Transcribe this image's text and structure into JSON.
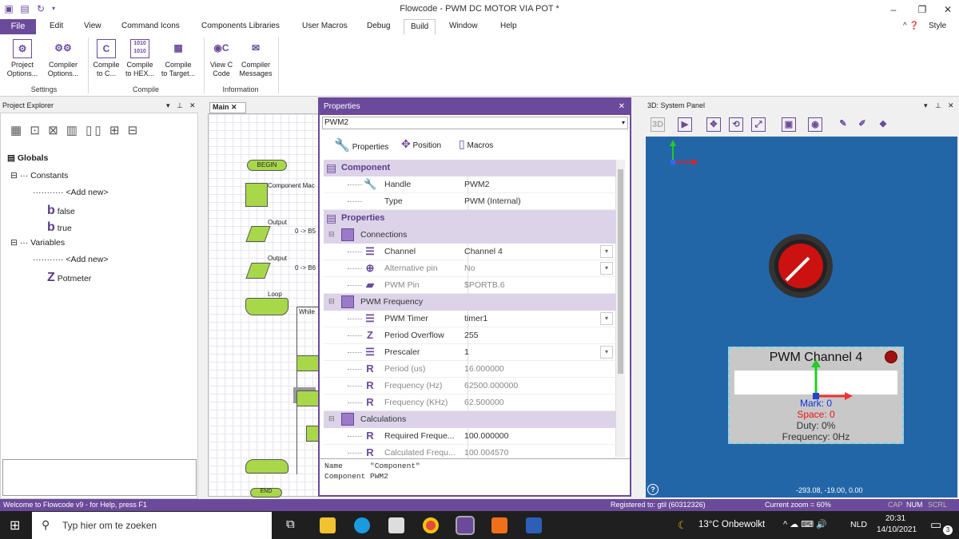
{
  "window": {
    "title": "Flowcode - PWM DC MOTOR VIA POT *"
  },
  "menu": [
    "File",
    "Edit",
    "View",
    "Command Icons",
    "Components Libraries",
    "User Macros",
    "Debug",
    "Build",
    "Window",
    "Help"
  ],
  "menu_style": "Style",
  "ribbon": {
    "buttons": [
      {
        "label1": "Project",
        "label2": "Options...",
        "icon": "gear-icon"
      },
      {
        "label1": "Compiler",
        "label2": "Options...",
        "icon": "gears-icon"
      },
      {
        "label1": "Compile",
        "label2": "to C...",
        "icon": "c-file-icon"
      },
      {
        "label1": "Compile",
        "label2": "to HEX...",
        "icon": "hex-file-icon"
      },
      {
        "label1": "Compile",
        "label2": "to Target...",
        "icon": "target-icon"
      },
      {
        "label1": "View C",
        "label2": "Code",
        "icon": "view-c-icon"
      },
      {
        "label1": "Compiler",
        "label2": "Messages",
        "icon": "messages-icon"
      }
    ],
    "groups": [
      "Settings",
      "Compile",
      "Information"
    ]
  },
  "project_explorer": {
    "title": "Project Explorer",
    "tree": [
      {
        "label": "Globals",
        "level": 0
      },
      {
        "label": "Constants",
        "level": 1
      },
      {
        "label": "<Add new>",
        "level": 2
      },
      {
        "label": "false",
        "level": 2,
        "icon": "b"
      },
      {
        "label": "true",
        "level": 2,
        "icon": "b"
      },
      {
        "label": "Variables",
        "level": 1
      },
      {
        "label": "<Add new>",
        "level": 2
      },
      {
        "label": "Potmeter",
        "level": 2,
        "icon": "Z"
      }
    ]
  },
  "main": {
    "tab": "Main",
    "flow": {
      "begin": "BEGIN",
      "end": "END",
      "component_macro": "Component Mac",
      "output1": "Output",
      "assign1": "0 -> B5",
      "output2": "Output",
      "assign2": "0 -> B6",
      "loop": "Loop",
      "while": "While"
    }
  },
  "properties": {
    "title": "Properties",
    "selected": "PWM2",
    "tabs": [
      "Properties",
      "Position",
      "Macros"
    ],
    "rows": [
      {
        "kind": "group",
        "label": "Component"
      },
      {
        "kind": "row",
        "key": "Handle",
        "value": "PWM2",
        "icon": "wrench"
      },
      {
        "kind": "row",
        "key": "Type",
        "value": "PWM (Internal)"
      },
      {
        "kind": "group",
        "label": "Properties"
      },
      {
        "kind": "sub",
        "label": "Connections"
      },
      {
        "kind": "row",
        "key": "Channel",
        "value": "Channel 4",
        "icon": "list",
        "dd": true
      },
      {
        "kind": "row",
        "key": "Alternative pin",
        "value": "No",
        "icon": "plus",
        "dd": true,
        "dim": true
      },
      {
        "kind": "row",
        "key": "PWM Pin",
        "value": "$PORTB.6",
        "icon": "pin",
        "dim": true
      },
      {
        "kind": "sub",
        "label": "PWM Frequency"
      },
      {
        "kind": "row",
        "key": "PWM Timer",
        "value": "timer1",
        "icon": "list",
        "dd": true
      },
      {
        "kind": "row",
        "key": "Period Overflow",
        "value": "255",
        "icon": "Z"
      },
      {
        "kind": "row",
        "key": "Prescaler",
        "value": "1",
        "icon": "list",
        "dd": true
      },
      {
        "kind": "row",
        "key": "Period (us)",
        "value": "16.000000",
        "icon": "R",
        "dim": true
      },
      {
        "kind": "row",
        "key": "Frequency (Hz)",
        "value": "62500.000000",
        "icon": "R",
        "dim": true
      },
      {
        "kind": "row",
        "key": "Frequency (KHz)",
        "value": "62.500000",
        "icon": "R",
        "dim": true
      },
      {
        "kind": "sub",
        "label": "Calculations"
      },
      {
        "kind": "row",
        "key": "Required Freque...",
        "value": "100.000000",
        "icon": "R"
      },
      {
        "kind": "row",
        "key": "Calculated Frequ...",
        "value": "100.004570",
        "icon": "R",
        "dim": true
      }
    ],
    "desc_line1": "Name      \"Component\"",
    "desc_line2": "Component PWM2"
  },
  "system_panel": {
    "title": "3D: System Panel",
    "pwm_title": "PWM Channel 4",
    "mark": "Mark: 0",
    "space": "Space: 0",
    "duty": "Duty: 0%",
    "frequency": "Frequency: 0Hz",
    "coords": "-293.08, -19.00, 0.00"
  },
  "status": {
    "left": "Welcome to Flowcode v9 - for Help, press F1",
    "registered": "Registered to: gtil (60312326)",
    "zoom": "Current zoom = 60%",
    "caps": "CAP",
    "num": "NUM",
    "scrl": "SCRL"
  },
  "taskbar": {
    "search": "Typ hier om te zoeken",
    "weather": "13°C  Onbewolkt",
    "lang": "NLD",
    "time": "20:31",
    "date": "14/10/2021",
    "notif": "3"
  },
  "colors": {
    "accent": "#6b4a9b",
    "flow_box": "#a8d84a",
    "system_bg": "#2366a8",
    "knob": "#cc1111"
  }
}
